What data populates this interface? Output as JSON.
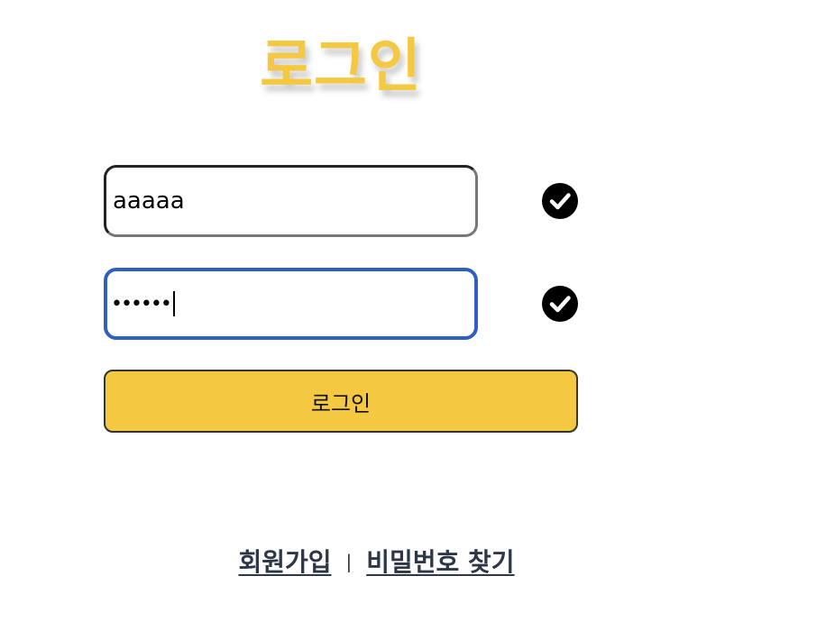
{
  "page": {
    "title": "로그인"
  },
  "form": {
    "id_field": {
      "value": "aaaaa",
      "valid": true
    },
    "password_field": {
      "masked_value": "••••••",
      "valid": true,
      "focused": true
    },
    "login_button_label": "로그인"
  },
  "links": {
    "signup": "회원가입",
    "separator": "|",
    "find_password": "비밀번호 찾기"
  },
  "icons": {
    "valid": "check-circle-icon"
  },
  "colors": {
    "accent": "#f5c842",
    "focus_border": "#2f5fbf",
    "link": "#2d3748"
  }
}
